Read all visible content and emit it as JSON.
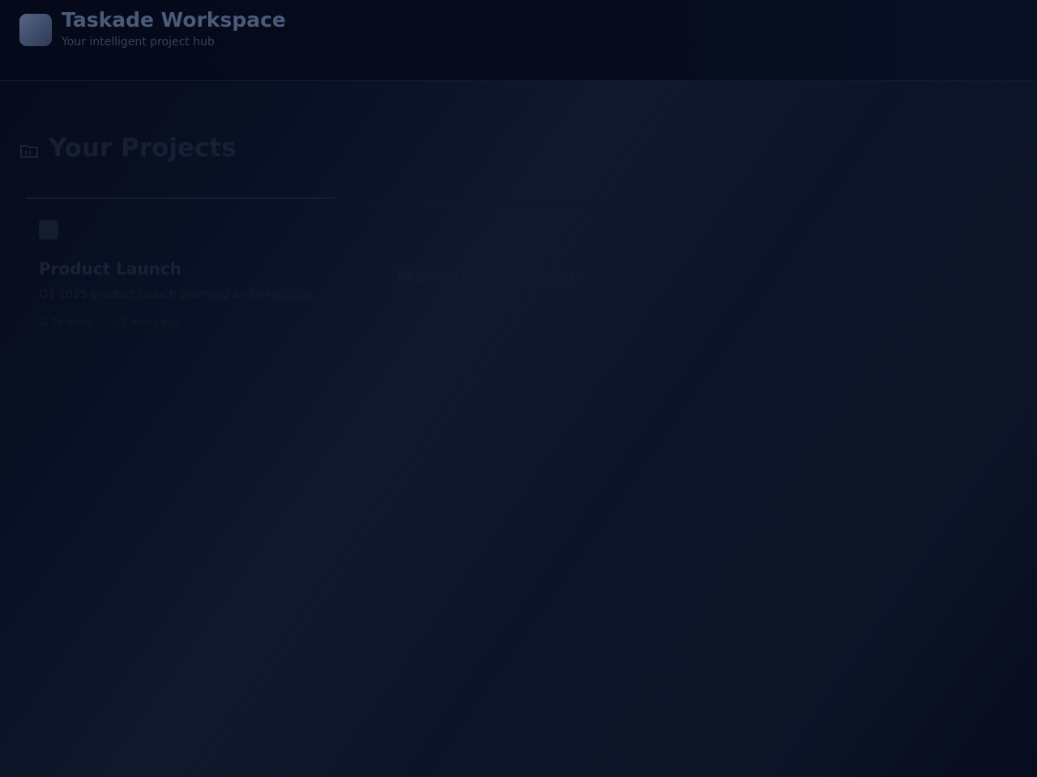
{
  "header": {
    "title": "Taskade Workspace",
    "subtitle": "Your intelligent project hub"
  },
  "section": {
    "icon": "folder-icon",
    "title": "Your Projects"
  },
  "projects": [
    {
      "icon": "document-icon",
      "name": "Product Launch",
      "description": "Q1 2025 product launch planning and execution",
      "tasks": "24 tasks",
      "updated": "2 hours ago"
    },
    {
      "name": "Marketing Campaign"
    }
  ],
  "colors": {
    "background": "#0a1226",
    "header_bg": "#050a1a",
    "title_text": "#4a5a78",
    "logo": "#4b5a78"
  }
}
